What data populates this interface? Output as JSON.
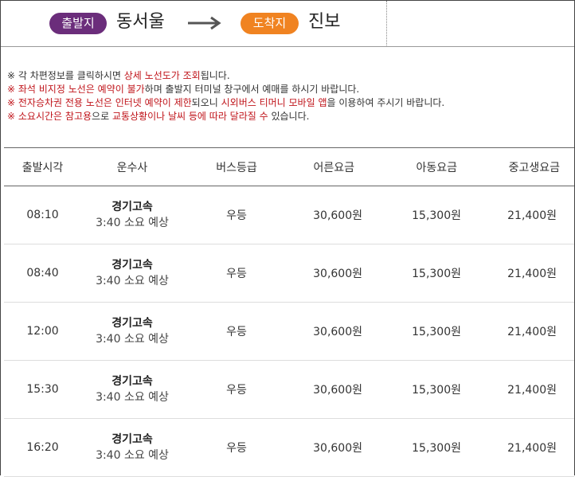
{
  "route": {
    "departure_badge": "출발지",
    "departure_place": "동서울",
    "arrival_badge": "도착지",
    "arrival_place": "진보",
    "departure_badge_color": "#6b2d7b",
    "arrival_badge_color": "#f08321"
  },
  "notes": [
    {
      "mark": "※",
      "parts": [
        {
          "t": " 각 차편정보를 클릭하시면 ",
          "hl": false
        },
        {
          "t": "상세 노선도가 조회",
          "hl": true
        },
        {
          "t": "됩니다.",
          "hl": false
        }
      ]
    },
    {
      "mark": "※",
      "parts": [
        {
          "t": " 좌석 비지정 노선은 예약이 불가",
          "hl": true
        },
        {
          "t": "하며 출발지 터미널 창구에서 예매를 하시기 바랍니다.",
          "hl": false
        }
      ]
    },
    {
      "mark": "※",
      "parts": [
        {
          "t": " 전자승차권 전용 노선은 인터넷 예약이 제한",
          "hl": true
        },
        {
          "t": "되오니 ",
          "hl": false
        },
        {
          "t": "시외버스 티머니 모바일 앱",
          "hl": true
        },
        {
          "t": "을 이용하여 주시기 바랍니다.",
          "hl": false
        }
      ]
    },
    {
      "mark": "※",
      "parts": [
        {
          "t": " 소요시간은 ",
          "hl": true
        },
        {
          "t": "참고용",
          "hl": true
        },
        {
          "t": "으로 ",
          "hl": false
        },
        {
          "t": "교통상황이나 날씨 등에 따라 달라질 수",
          "hl": true
        },
        {
          "t": " 있습니다.",
          "hl": false
        }
      ]
    }
  ],
  "table": {
    "headers": [
      "출발시각",
      "운수사",
      "버스등급",
      "어른요금",
      "아동요금",
      "중고생요금"
    ],
    "rows": [
      {
        "time": "08:10",
        "company": "경기고속",
        "duration": "3:40 소요 예상",
        "grade": "우등",
        "adult": "30,600원",
        "child": "15,300원",
        "youth": "21,400원"
      },
      {
        "time": "08:40",
        "company": "경기고속",
        "duration": "3:40 소요 예상",
        "grade": "우등",
        "adult": "30,600원",
        "child": "15,300원",
        "youth": "21,400원"
      },
      {
        "time": "12:00",
        "company": "경기고속",
        "duration": "3:40 소요 예상",
        "grade": "우등",
        "adult": "30,600원",
        "child": "15,300원",
        "youth": "21,400원"
      },
      {
        "time": "15:30",
        "company": "경기고속",
        "duration": "3:40 소요 예상",
        "grade": "우등",
        "adult": "30,600원",
        "child": "15,300원",
        "youth": "21,400원"
      },
      {
        "time": "16:20",
        "company": "경기고속",
        "duration": "3:40 소요 예상",
        "grade": "우등",
        "adult": "30,600원",
        "child": "15,300원",
        "youth": "21,400원"
      }
    ]
  }
}
